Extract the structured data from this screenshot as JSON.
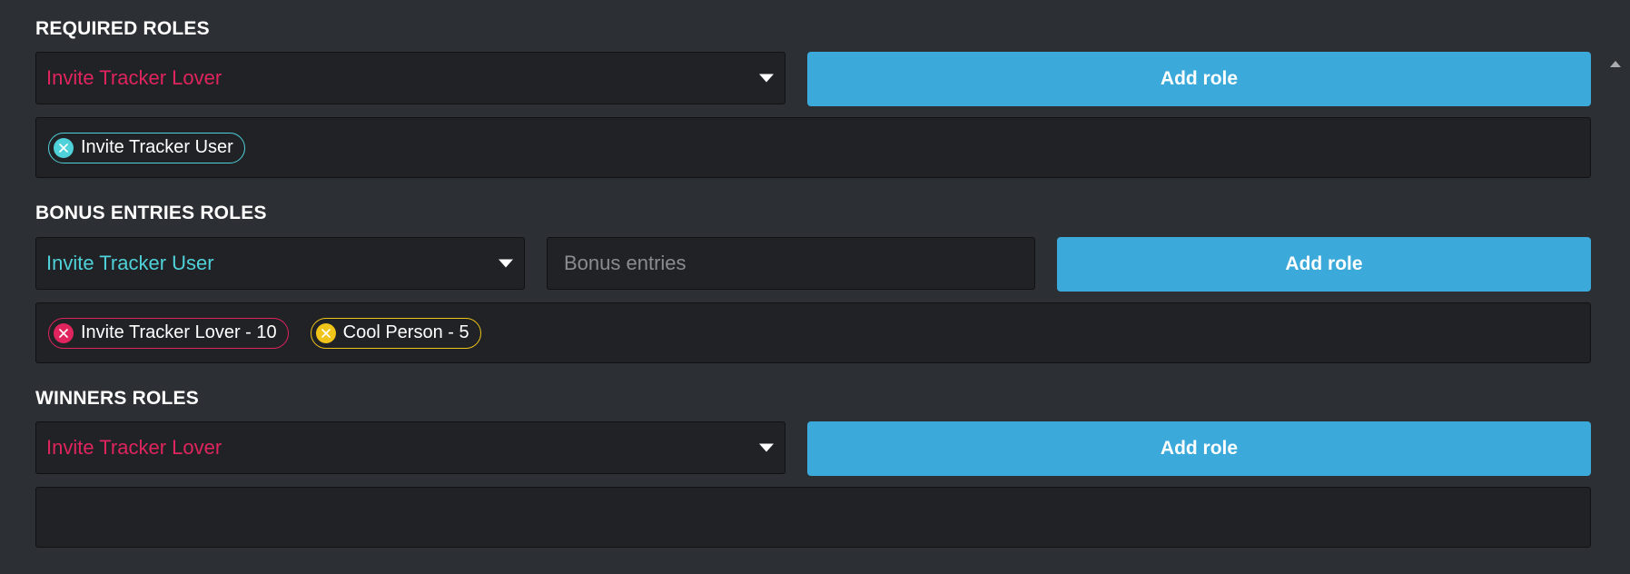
{
  "sections": {
    "required": {
      "title": "REQUIRED ROLES",
      "select_value": "Invite Tracker Lover",
      "select_color": "#e0245e",
      "button_label": "Add role",
      "chips": [
        {
          "label": "Invite Tracker User",
          "color": "#4fd1d9"
        }
      ]
    },
    "bonus": {
      "title": "BONUS ENTRIES ROLES",
      "select_value": "Invite Tracker User",
      "select_color": "#4fd1d9",
      "input_placeholder": "Bonus entries",
      "input_value": "",
      "button_label": "Add role",
      "chips": [
        {
          "label": "Invite Tracker Lover - 10",
          "color": "#e0245e"
        },
        {
          "label": "Cool Person - 5",
          "color": "#f0c419"
        }
      ]
    },
    "winners": {
      "title": "WINNERS ROLES",
      "select_value": "Invite Tracker Lover",
      "select_color": "#e0245e",
      "button_label": "Add role",
      "chips": []
    }
  },
  "icons": {
    "dropdown": "caret-down-icon",
    "chip_remove": "close-circle-icon",
    "scroll_up": "scroll-up-arrow-icon"
  },
  "colors": {
    "background": "#2c2f33",
    "field": "#202225",
    "accent": "#3ba9da"
  }
}
